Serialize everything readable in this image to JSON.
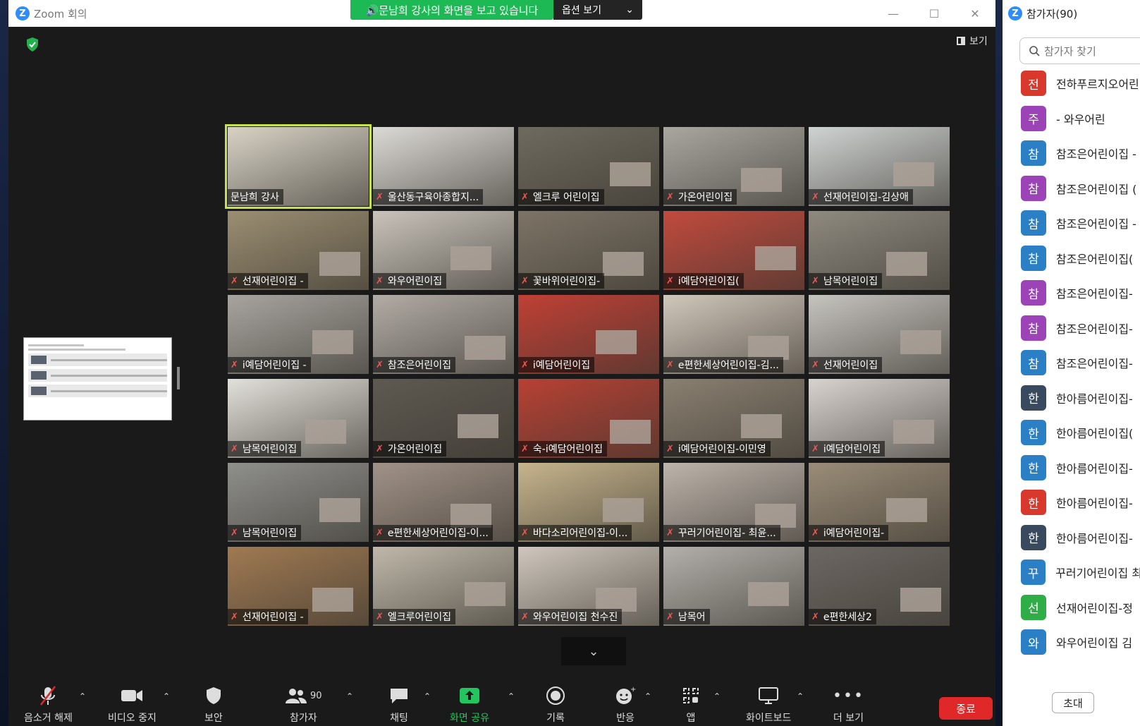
{
  "window": {
    "title": "Zoom 회의",
    "logo_letter": "Z"
  },
  "share_banner": {
    "text": "🔊문남희 강사의 화면을 보고 있습니다",
    "options_label": "옵션 보기"
  },
  "view_button": {
    "label": "보기"
  },
  "tiles": [
    {
      "label": "문남희 강사",
      "muted": false,
      "bg": "#d8d2c6"
    },
    {
      "label": "울산동구육아종합지...",
      "muted": true,
      "bg": "#dcdad6"
    },
    {
      "label": "엘크루 어린이집",
      "muted": true,
      "bg": "#6e6a5e"
    },
    {
      "label": "가온어린이집",
      "muted": true,
      "bg": "#a9a7a0"
    },
    {
      "label": "선재어린이집-김상애",
      "muted": true,
      "bg": "#cfd3d2"
    },
    {
      "label": "선재어린이집 -",
      "muted": true,
      "bg": "#9b8e72"
    },
    {
      "label": "와우어린이집",
      "muted": true,
      "bg": "#c9c3bb"
    },
    {
      "label": "꽃바위어린이집-",
      "muted": true,
      "bg": "#7d7466"
    },
    {
      "label": "i예담어린이집(",
      "muted": true,
      "bg": "#c24a3e"
    },
    {
      "label": "남목어린이집",
      "muted": true,
      "bg": "#8f8a80"
    },
    {
      "label": "i예담어린이집 -",
      "muted": true,
      "bg": "#a8a49f"
    },
    {
      "label": "참조은어린이집",
      "muted": true,
      "bg": "#b2aca5"
    },
    {
      "label": "i예담어린이집",
      "muted": true,
      "bg": "#c04035"
    },
    {
      "label": "e편한세상어린이집-김...",
      "muted": true,
      "bg": "#d1c7bb"
    },
    {
      "label": "선재어린이집",
      "muted": true,
      "bg": "#c6c4bf"
    },
    {
      "label": "남목어린이집",
      "muted": true,
      "bg": "#e2e0da"
    },
    {
      "label": "가온어린이집",
      "muted": true,
      "bg": "#5e5a52"
    },
    {
      "label": "숙-i예담어린이집",
      "muted": true,
      "bg": "#b84134"
    },
    {
      "label": "i예담어린이집-이민영",
      "muted": true,
      "bg": "#8a8071"
    },
    {
      "label": "i예담어린이집",
      "muted": true,
      "bg": "#d8d3cf"
    },
    {
      "label": "남목어린이집",
      "muted": true,
      "bg": "#8f8f8c"
    },
    {
      "label": "e편한세상어린이집-이...",
      "muted": true,
      "bg": "#a19288"
    },
    {
      "label": "바다소리어린이집-이...",
      "muted": true,
      "bg": "#c6b48c"
    },
    {
      "label": "꾸러기어린이집- 최윤...",
      "muted": true,
      "bg": "#bdb4ab"
    },
    {
      "label": "i예담어린이집-",
      "muted": true,
      "bg": "#9a8c78"
    },
    {
      "label": "선재어린이집 -",
      "muted": true,
      "bg": "#a07a52"
    },
    {
      "label": "엘크루어린이집",
      "muted": true,
      "bg": "#bfb8aa"
    },
    {
      "label": "와우어린이집 천수진",
      "muted": true,
      "bg": "#cfc7bd"
    },
    {
      "label": "남목어",
      "muted": true,
      "bg": "#b3b0ab"
    },
    {
      "label": "e편한세상2",
      "muted": true,
      "bg": "#6c6762"
    }
  ],
  "toolbar": {
    "unmute": "음소거 해제",
    "stop_video": "비디오 중지",
    "security": "보안",
    "participants": "참가자",
    "participants_count": "90",
    "chat": "채팅",
    "share_screen": "화면 공유",
    "record": "기록",
    "reactions": "반응",
    "apps": "앱",
    "whiteboard": "화이트보드",
    "more": "더 보기",
    "end": "종료"
  },
  "panel": {
    "title": "참가자(90)",
    "search_placeholder": "참가자 찾기",
    "invite": "초대",
    "participants": [
      {
        "initial": "전",
        "name": "전하푸르지오어린",
        "color": "#d9382c"
      },
      {
        "initial": "주",
        "name": "- 와우어린",
        "color": "#9b43b7"
      },
      {
        "initial": "참",
        "name": "참조은어린이집 -",
        "color": "#2b7fc4"
      },
      {
        "initial": "참",
        "name": "참조은어린이집 (",
        "color": "#9b43b7"
      },
      {
        "initial": "참",
        "name": "참조은어린이집 -",
        "color": "#2b7fc4"
      },
      {
        "initial": "참",
        "name": "참조은어린이집(",
        "color": "#2b7fc4"
      },
      {
        "initial": "참",
        "name": "참조은어린이집-",
        "color": "#9b43b7"
      },
      {
        "initial": "참",
        "name": "참조은어린이집-",
        "color": "#9b43b7"
      },
      {
        "initial": "참",
        "name": "참조은어린이집-",
        "color": "#2b7fc4"
      },
      {
        "initial": "한",
        "name": "한아름어린이집-",
        "color": "#3a4a5e"
      },
      {
        "initial": "한",
        "name": "한아름어린이집(",
        "color": "#2b7fc4"
      },
      {
        "initial": "한",
        "name": "한아름어린이집-",
        "color": "#2b7fc4"
      },
      {
        "initial": "한",
        "name": "한아름어린이집-",
        "color": "#d9382c"
      },
      {
        "initial": "한",
        "name": "한아름어린이집-",
        "color": "#3a4a5e"
      },
      {
        "initial": "꾸",
        "name": "꾸러기어린이집 최",
        "color": "#2b7fc4"
      },
      {
        "initial": "선",
        "name": "선재어린이집-정",
        "color": "#2fae48"
      },
      {
        "initial": "와",
        "name": "와우어린이집 김",
        "color": "#2b7fc4"
      }
    ]
  }
}
